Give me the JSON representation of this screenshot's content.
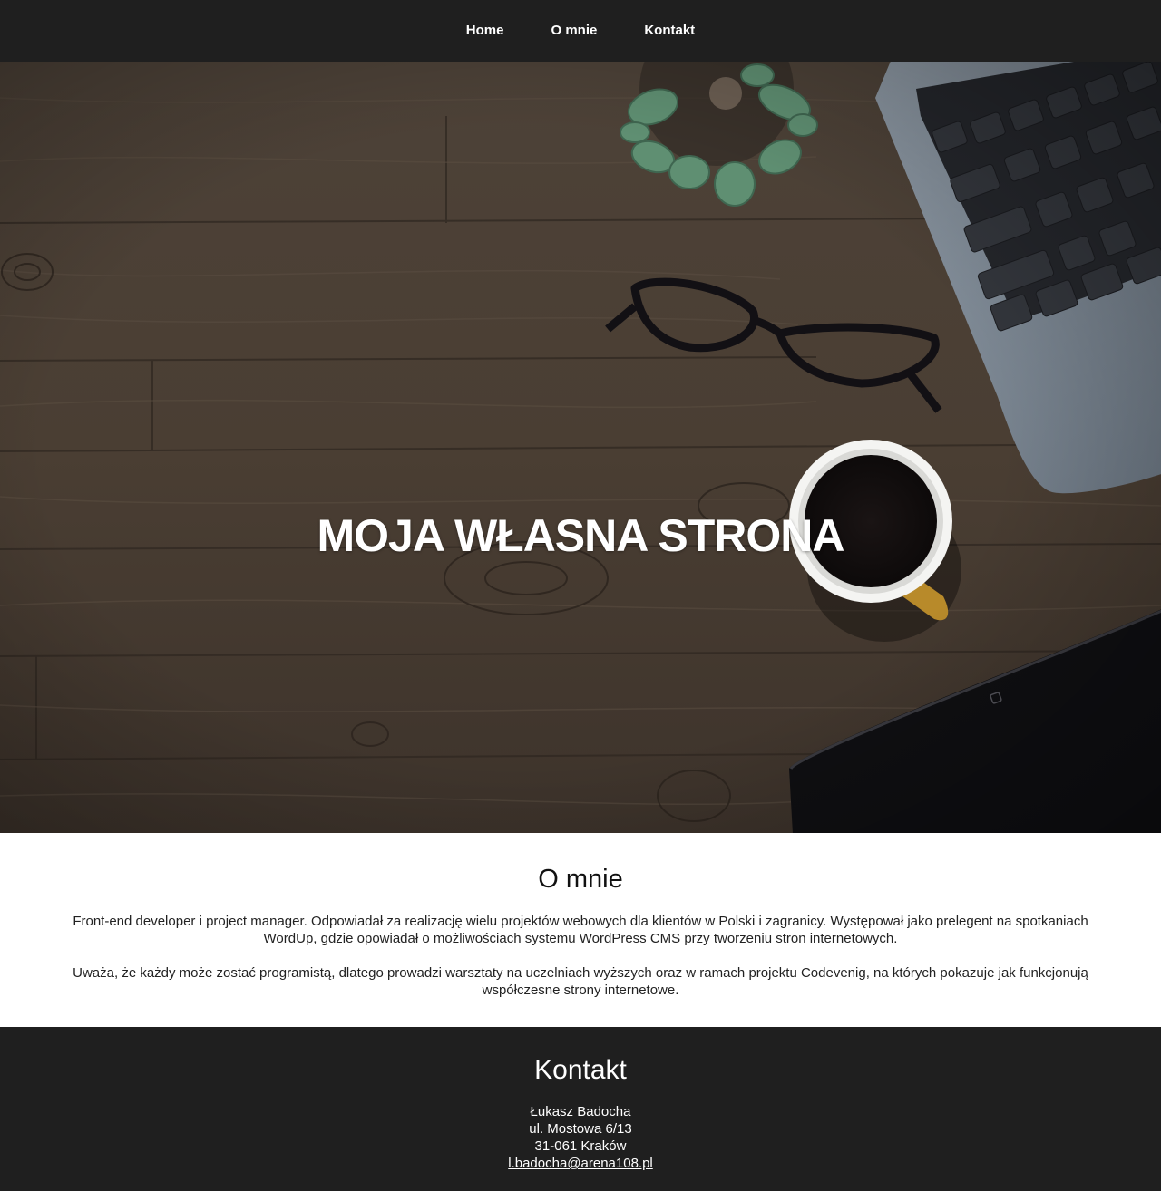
{
  "nav": {
    "items": [
      {
        "label": "Home"
      },
      {
        "label": "O mnie"
      },
      {
        "label": "Kontakt"
      }
    ]
  },
  "hero": {
    "title": "MOJA WŁASNA STRONA"
  },
  "about": {
    "heading": "O mnie",
    "paragraphs": [
      "Front-end developer i project manager. Odpowiadał za realizację wielu projektów webowych dla klientów w Polski i zagranicy. Występował jako prelegent na spotkaniach WordUp, gdzie opowiadał o możliwościach systemu WordPress CMS przy tworzeniu stron internetowych.",
      "Uważa, że każdy może zostać programistą, dlatego prowadzi warsztaty na uczelniach wyższych oraz w ramach projektu Codevenig, na których pokazuje jak funkcjonują współczesne strony internetowe."
    ]
  },
  "contact": {
    "heading": "Kontakt",
    "name": "Łukasz Badocha",
    "street": "ul. Mostowa 6/13",
    "city": "31-061 Kraków",
    "email": "l.badocha@arena108.pl"
  },
  "colors": {
    "nav_bg": "#1f1f1f",
    "footer_bg": "#1f1f1f",
    "wood": "#4a3f35"
  }
}
